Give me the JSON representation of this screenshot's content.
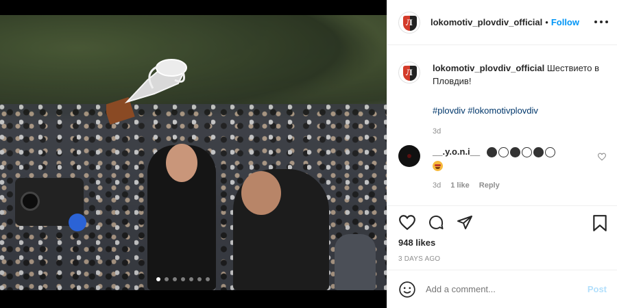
{
  "header": {
    "username": "lokomotiv_plovdiv_official",
    "separator": "•",
    "follow_label": "Follow",
    "more_icon": "more-horizontal-icon"
  },
  "caption": {
    "username": "lokomotiv_plovdiv_official",
    "text": "Шествието в Пловдив!",
    "hashtags": "#plovdiv #lokomotivplovdiv",
    "time": "3d"
  },
  "comment": {
    "username": "__.y.o.n.i__",
    "time": "3d",
    "likes": "1 like",
    "reply_label": "Reply"
  },
  "actions": {
    "likes": "948 likes",
    "posted": "3 DAYS AGO"
  },
  "add_comment": {
    "placeholder": "Add a comment...",
    "post_label": "Post"
  },
  "carousel": {
    "count": 7,
    "active_index": 0
  },
  "colors": {
    "accent": "#0095f6",
    "post_disabled": "#b2dffc",
    "muted": "#8e8e8e"
  }
}
